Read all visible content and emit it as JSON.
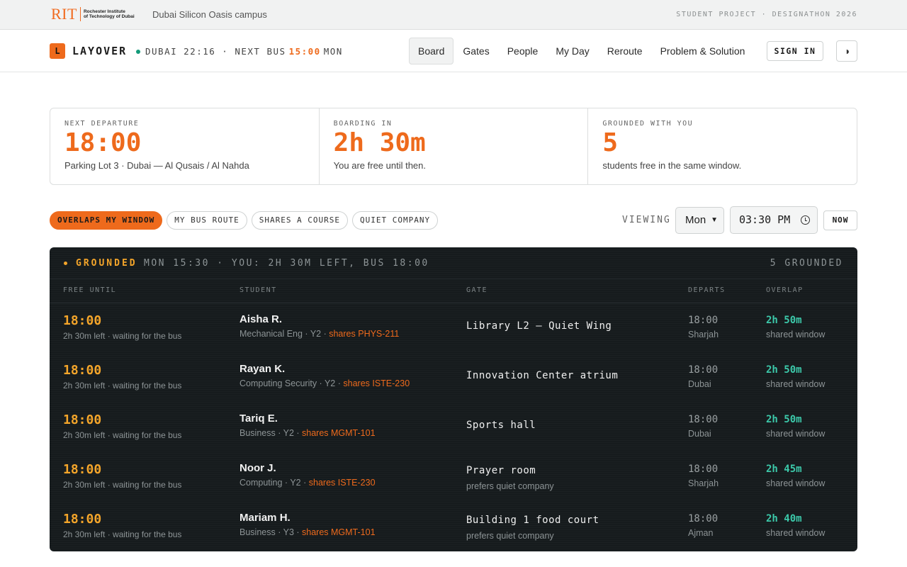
{
  "strip": {
    "logo_mark": "RIT",
    "logo_text_1": "Rochester Institute",
    "logo_text_2": "of Technology of Dubai",
    "campus": "Dubai Silicon Oasis campus",
    "right": "STUDENT PROJECT · DESIGNATHON 2026"
  },
  "nav": {
    "brand_letter": "L",
    "brand_name": "LAYOVER",
    "clock_prefix": "DUBAI 22:16 · NEXT BUS",
    "clock_bus": "15:00",
    "clock_suffix": "MON",
    "tabs": [
      "Board",
      "Gates",
      "People",
      "My Day",
      "Reroute",
      "Problem & Solution"
    ],
    "active_tab": "Board",
    "sign_in": "SIGN IN",
    "theme_icon": "◑"
  },
  "stats": [
    {
      "label": "NEXT DEPARTURE",
      "value": "18:00",
      "sub": "Parking Lot 3 · Dubai — Al Qusais / Al Nahda"
    },
    {
      "label": "BOARDING IN",
      "value": "2h 30m",
      "sub": "You are free until then."
    },
    {
      "label": "GROUNDED WITH YOU",
      "value": "5",
      "sub": "students free in the same window."
    }
  ],
  "filters": {
    "chips": [
      "OVERLAPS MY WINDOW",
      "MY BUS ROUTE",
      "SHARES A COURSE",
      "QUIET COMPANY"
    ],
    "viewing_label": "VIEWING",
    "day": "Mon",
    "time": "03:30 PM",
    "now": "NOW"
  },
  "board": {
    "title": "GROUNDED",
    "subtitle": "MON 15:30 · YOU: 2H 30M LEFT, BUS 18:00",
    "count": "5 GROUNDED",
    "columns": [
      "FREE UNTIL",
      "STUDENT",
      "GATE",
      "DEPARTS",
      "OVERLAP"
    ],
    "rows": [
      {
        "free_until": "18:00",
        "left": "2h 30m left · waiting for the bus",
        "name": "Aisha R.",
        "meta": "Mechanical Eng · Y2 ·",
        "shares": "shares PHYS-211",
        "gate": "Library L2 — Quiet Wing",
        "gate_note": "",
        "departs": "18:00",
        "city": "Sharjah",
        "overlap": "2h 50m",
        "overlap_sub": "shared window"
      },
      {
        "free_until": "18:00",
        "left": "2h 30m left · waiting for the bus",
        "name": "Rayan K.",
        "meta": "Computing Security · Y2 ·",
        "shares": "shares ISTE-230",
        "gate": "Innovation Center atrium",
        "gate_note": "",
        "departs": "18:00",
        "city": "Dubai",
        "overlap": "2h 50m",
        "overlap_sub": "shared window"
      },
      {
        "free_until": "18:00",
        "left": "2h 30m left · waiting for the bus",
        "name": "Tariq E.",
        "meta": "Business · Y2 ·",
        "shares": "shares MGMT-101",
        "gate": "Sports hall",
        "gate_note": "",
        "departs": "18:00",
        "city": "Dubai",
        "overlap": "2h 50m",
        "overlap_sub": "shared window"
      },
      {
        "free_until": "18:00",
        "left": "2h 30m left · waiting for the bus",
        "name": "Noor J.",
        "meta": "Computing · Y2 ·",
        "shares": "shares ISTE-230",
        "gate": "Prayer room",
        "gate_note": "prefers quiet company",
        "departs": "18:00",
        "city": "Sharjah",
        "overlap": "2h 45m",
        "overlap_sub": "shared window"
      },
      {
        "free_until": "18:00",
        "left": "2h 30m left · waiting for the bus",
        "name": "Mariam H.",
        "meta": "Business · Y3 ·",
        "shares": "shares MGMT-101",
        "gate": "Building 1 food court",
        "gate_note": "prefers quiet company",
        "departs": "18:00",
        "city": "Ajman",
        "overlap": "2h 40m",
        "overlap_sub": "shared window"
      }
    ]
  },
  "colors": {
    "accent": "#ee6a1c",
    "board_bg": "#161b1d",
    "amber": "#f4a52a",
    "teal": "#3cc9aa"
  }
}
